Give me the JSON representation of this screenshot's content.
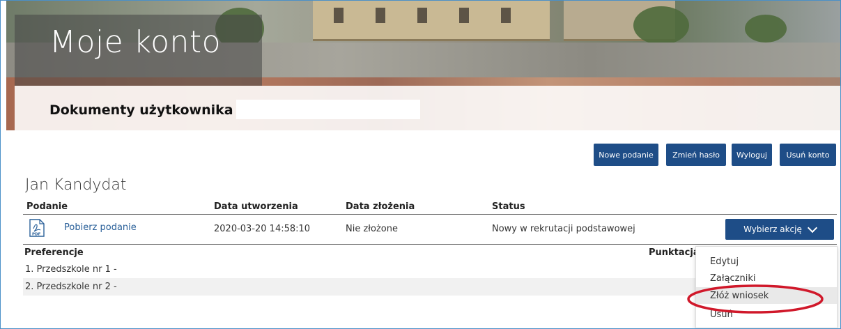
{
  "hero": {
    "title": "Moje konto",
    "subtitle": "Dokumenty użytkownika"
  },
  "toolbar": {
    "new_label": "Nowe podanie",
    "change_password_label": "Zmień hasło",
    "logout_label": "Wyloguj",
    "delete_account_label": "Usuń konto"
  },
  "user": {
    "name": "Jan Kandydat"
  },
  "table": {
    "headers": [
      "Podanie",
      "Data utworzenia",
      "Data złożenia",
      "Status"
    ],
    "row": {
      "file_icon": "pdf-icon",
      "link": "Pobierz podanie",
      "created": "2020-03-20 14:58:10",
      "submitted": "Nie złożone",
      "status": "Nowy w rekrutacji podstawowej",
      "action_label": "Wybierz akcję"
    }
  },
  "preferences": {
    "header": "Preferencje",
    "score_header": "Punktacja",
    "items": [
      "1. Przedszkole nr 1 -",
      "2. Przedszkole nr 2 -"
    ]
  },
  "dropdown": {
    "items": [
      "Edytuj",
      "Załączniki",
      "Złóż wniosek",
      "Usuń"
    ],
    "highlighted": "Złóż wniosek"
  },
  "colors": {
    "primary": "#1e4d87",
    "link": "#2a6099",
    "annotation": "#d0182a"
  }
}
